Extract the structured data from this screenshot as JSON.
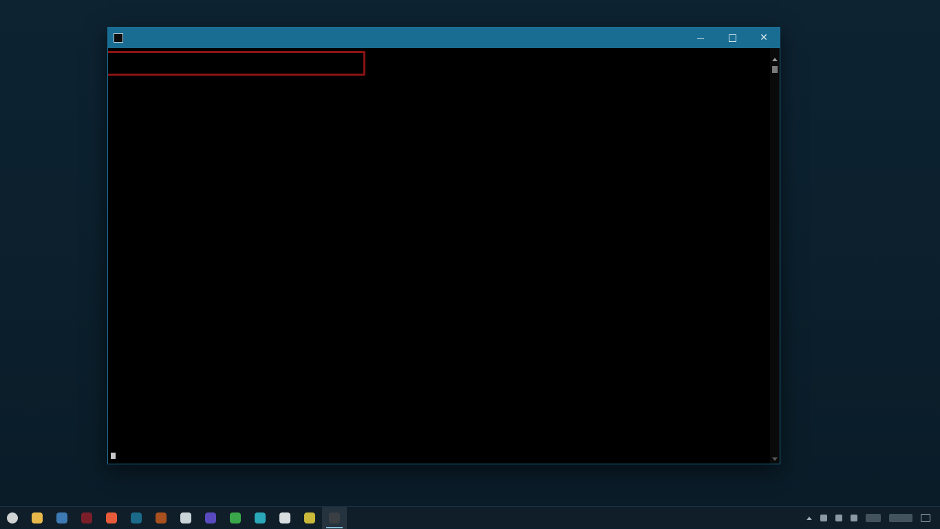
{
  "window": {
    "title": ""
  },
  "console": {
    "command": "",
    "header": "",
    "rows": [
      [
        "",
        "",
        "",
        "",
        "",
        "",
        "",
        "",
        ""
      ]
    ]
  },
  "taskbar": {
    "apps": [
      {
        "name": "file-explorer",
        "color": "#e8b84a"
      },
      {
        "name": "settings",
        "color": "#3d7ab3"
      },
      {
        "name": "app-red",
        "color": "#7a1f2a"
      },
      {
        "name": "app-orange",
        "color": "#e85b3a"
      },
      {
        "name": "app-teal",
        "color": "#1b6a8a"
      },
      {
        "name": "app-brown",
        "color": "#a8501e"
      },
      {
        "name": "app-grey",
        "color": "#c9d3d8"
      },
      {
        "name": "app-purple",
        "color": "#5a4ac0"
      },
      {
        "name": "app-green",
        "color": "#3aa84a"
      },
      {
        "name": "app-cyan",
        "color": "#2aa7b8"
      },
      {
        "name": "app-white",
        "color": "#d8dde0"
      },
      {
        "name": "app-yellow",
        "color": "#c9b83a"
      },
      {
        "name": "command-prompt",
        "color": "#3a3f44",
        "active": true
      }
    ]
  },
  "colors": {
    "titlebar": "#1a6d92",
    "highlight": "#8b1414",
    "console_bg": "#000000"
  }
}
